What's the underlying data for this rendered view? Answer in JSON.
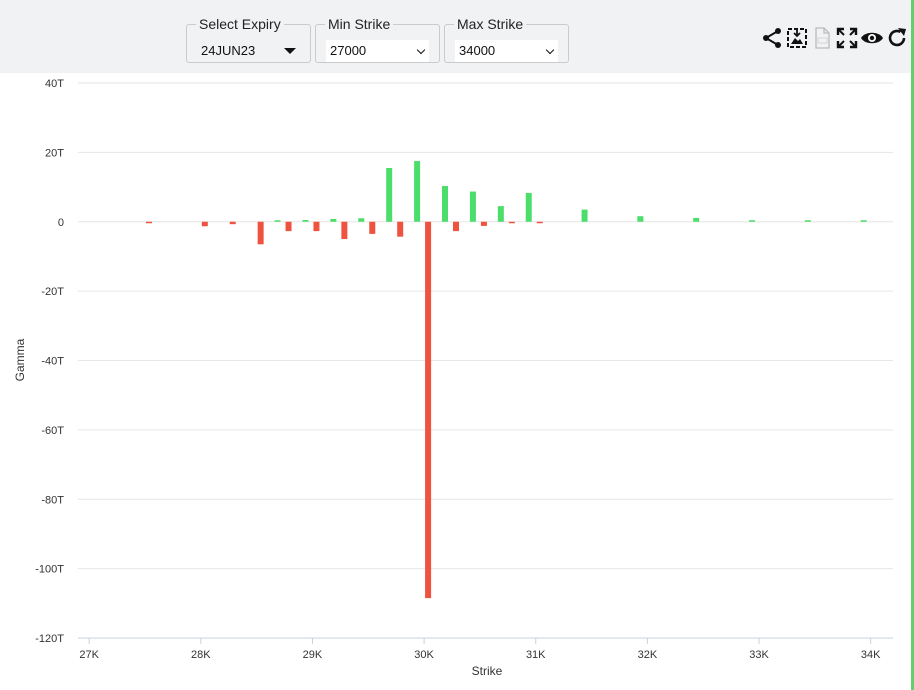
{
  "controls": {
    "expiry": {
      "label": "Select Expiry",
      "value": "24JUN23"
    },
    "min_strike": {
      "label": "Min Strike",
      "value": "27000"
    },
    "max_strike": {
      "label": "Max Strike",
      "value": "34000"
    }
  },
  "toolbar_icons": [
    "share-icon",
    "image-download-icon",
    "csv-download-icon",
    "fullscreen-icon",
    "eye-icon",
    "refresh-icon"
  ],
  "colors": {
    "positive": "#4cde6a",
    "negative": "#ef5340",
    "toolbar_bg": "#f1f2f4",
    "accent": "#5fd06b"
  },
  "chart_data": {
    "type": "bar",
    "xlabel": "Strike",
    "ylabel": "Gamma",
    "xlim": [
      26900,
      34200
    ],
    "ylim": [
      -120,
      40
    ],
    "xticks": [
      {
        "value": 27000,
        "label": "27K"
      },
      {
        "value": 28000,
        "label": "28K"
      },
      {
        "value": 29000,
        "label": "29K"
      },
      {
        "value": 30000,
        "label": "30K"
      },
      {
        "value": 31000,
        "label": "31K"
      },
      {
        "value": 32000,
        "label": "32K"
      },
      {
        "value": 33000,
        "label": "33K"
      },
      {
        "value": 34000,
        "label": "34K"
      }
    ],
    "yticks": [
      {
        "value": 40,
        "label": "40T"
      },
      {
        "value": 20,
        "label": "20T"
      },
      {
        "value": 0,
        "label": "0"
      },
      {
        "value": -20,
        "label": "-20T"
      },
      {
        "value": -40,
        "label": "-40T"
      },
      {
        "value": -60,
        "label": "-60T"
      },
      {
        "value": -80,
        "label": "-80T"
      },
      {
        "value": -100,
        "label": "-100T"
      },
      {
        "value": -120,
        "label": "-120T"
      }
    ],
    "grid": true,
    "series": [
      {
        "sign": "positive",
        "points": [
          {
            "x": 28750,
            "y": 0.3
          },
          {
            "x": 29000,
            "y": 0.5
          },
          {
            "x": 29250,
            "y": 0.8
          },
          {
            "x": 29500,
            "y": 1.0
          },
          {
            "x": 29750,
            "y": 15.5
          },
          {
            "x": 30000,
            "y": 17.5
          },
          {
            "x": 30250,
            "y": 10.3
          },
          {
            "x": 30500,
            "y": 8.7
          },
          {
            "x": 30750,
            "y": 4.5
          },
          {
            "x": 31000,
            "y": 8.3
          },
          {
            "x": 31500,
            "y": 3.5
          },
          {
            "x": 32000,
            "y": 1.6
          },
          {
            "x": 32500,
            "y": 1.1
          },
          {
            "x": 33000,
            "y": 0.2
          },
          {
            "x": 33500,
            "y": 0.2
          },
          {
            "x": 34000,
            "y": 0.2
          }
        ]
      },
      {
        "sign": "negative",
        "points": [
          {
            "x": 27500,
            "y": -0.4
          },
          {
            "x": 28000,
            "y": -1.3
          },
          {
            "x": 28250,
            "y": -0.7
          },
          {
            "x": 28500,
            "y": -6.5
          },
          {
            "x": 28750,
            "y": -2.7
          },
          {
            "x": 29000,
            "y": -2.7
          },
          {
            "x": 29250,
            "y": -5.0
          },
          {
            "x": 29500,
            "y": -3.5
          },
          {
            "x": 29750,
            "y": -4.3
          },
          {
            "x": 30000,
            "y": -108.5
          },
          {
            "x": 30250,
            "y": -2.7
          },
          {
            "x": 30500,
            "y": -1.2
          },
          {
            "x": 30750,
            "y": -0.3
          },
          {
            "x": 31000,
            "y": -0.3
          }
        ]
      }
    ]
  }
}
